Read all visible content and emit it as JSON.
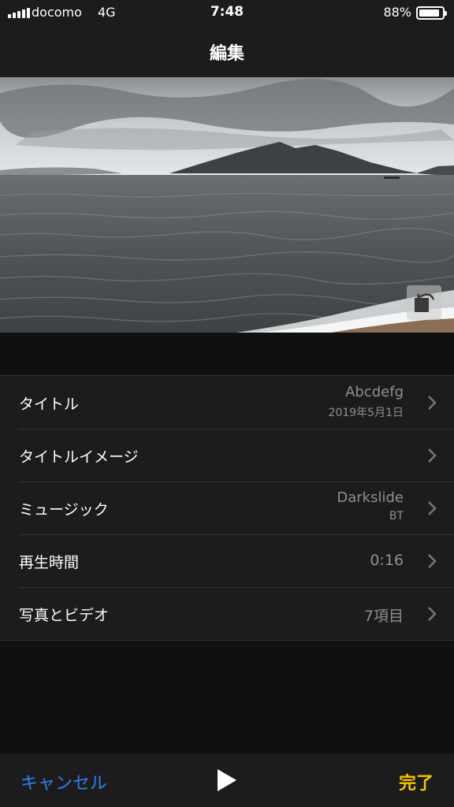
{
  "status_bar": {
    "carrier": "docomo",
    "network": "4G",
    "time": "7:48",
    "battery_percent": "88%",
    "battery_level": 0.88
  },
  "nav": {
    "title": "編集"
  },
  "preview": {
    "image": "lake-landscape-photo",
    "rotate_icon": "rotate-icon"
  },
  "settings": {
    "rows": [
      {
        "label": "タイトル",
        "value": "Abcdefg",
        "subvalue": "2019年5月1日"
      },
      {
        "label": "タイトルイメージ",
        "value": ""
      },
      {
        "label": "ミュージック",
        "value": "Darkslide",
        "subvalue": "BT"
      },
      {
        "label": "再生時間",
        "value": "0:16"
      },
      {
        "label": "写真とビデオ",
        "value": "7項目"
      }
    ]
  },
  "toolbar": {
    "cancel_label": "キャンセル",
    "play_icon": "play-icon",
    "done_label": "完了"
  },
  "colors": {
    "accent_blue": "#2f7ff5",
    "accent_yellow": "#f7c300",
    "background": "#101010",
    "surface": "#1c1c1c"
  }
}
